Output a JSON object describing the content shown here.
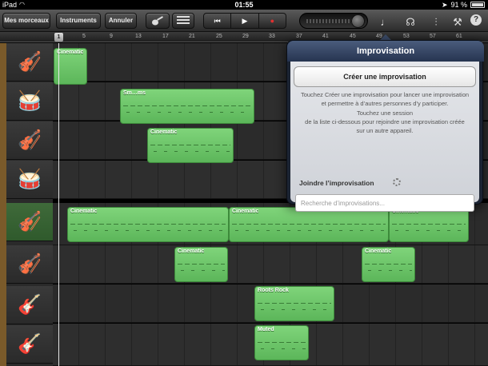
{
  "status_bar": {
    "carrier": "iPad",
    "wifi_icon": "wifi-icon",
    "time": "01:55",
    "battery": "91 %"
  },
  "toolbar": {
    "my_songs": "Mes morceaux",
    "instruments": "Instruments",
    "undo": "Annuler",
    "icons": [
      "guitar-icon",
      "tracks-view-icon",
      "rewind-icon",
      "play-icon",
      "record-icon",
      "metronome-icon",
      "improvisation-icon",
      "mixer-icon",
      "settings-icon",
      "help-icon"
    ],
    "record_color": "#e03030"
  },
  "ruler": {
    "bars": [
      "1",
      "5",
      "9",
      "13",
      "17",
      "21",
      "25",
      "29",
      "33",
      "37",
      "41",
      "45",
      "49",
      "53",
      "57",
      "61"
    ]
  },
  "tracks": [
    {
      "instrument": "violin-icon",
      "selected": false
    },
    {
      "instrument": "drum-kit-icon",
      "selected": false
    },
    {
      "instrument": "violin-icon",
      "selected": false
    },
    {
      "instrument": "drum-kit-blue-icon",
      "selected": false
    },
    {
      "instrument": "violin-icon",
      "selected": true
    },
    {
      "instrument": "violin-icon",
      "selected": false
    },
    {
      "instrument": "electric-guitar-icon",
      "selected": false
    },
    {
      "instrument": "bass-guitar-icon",
      "selected": false
    }
  ],
  "regions": {
    "r1": "Cinematic",
    "r2": "Sm…ms",
    "r3": "Cinematic",
    "r4": "Cinematic",
    "r5": "Cinematic",
    "r6": "Cinematic",
    "r7": "Cinematic",
    "r8": "Roots Rock",
    "r9": "Muted"
  },
  "region_color": "#6cc469",
  "popover": {
    "title": "Improvisation",
    "create_button": "Créer une improvisation",
    "description": "Touchez Créer une improvisation pour lancer une improvisation\net permettre à d’autres personnes d’y participer.\nTouchez une session\nde la liste ci-dessous pour rejoindre une improvisation créée\nsur un autre appareil.",
    "join_label": "Joindre l’improvisation",
    "search_placeholder": "Recherche d’improvisations..."
  }
}
